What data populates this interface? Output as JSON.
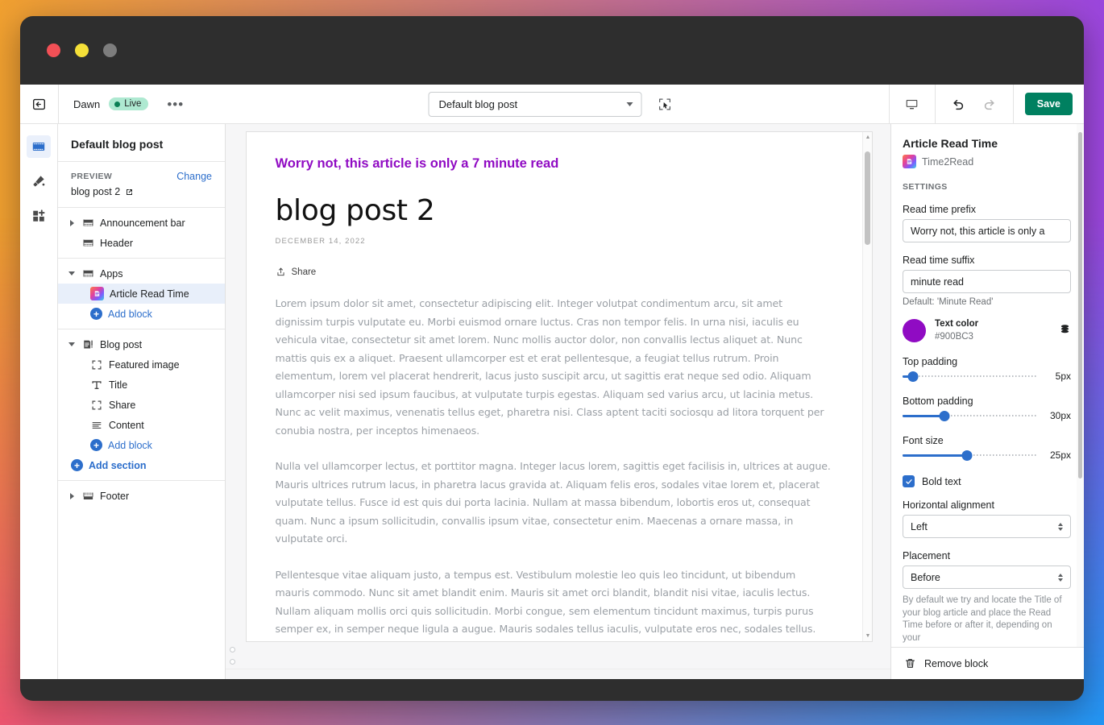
{
  "window": {
    "traffic_lights": [
      "close",
      "minimize",
      "maximize"
    ]
  },
  "toolbar": {
    "exit_icon": "exit-to-app-icon",
    "theme_name": "Dawn",
    "status_badge": "Live",
    "more_label": "•••",
    "page_selector_value": "Default blog post",
    "inspector_icon": "select-element-icon",
    "device_icon": "desktop-icon",
    "undo_icon": "undo-icon",
    "redo_icon": "redo-icon",
    "save_label": "Save"
  },
  "rail": {
    "items": [
      {
        "name": "sections-icon",
        "label": "Sections",
        "active": true
      },
      {
        "name": "theme-settings-icon",
        "label": "Theme settings",
        "active": false
      },
      {
        "name": "app-embeds-icon",
        "label": "App embeds",
        "active": false
      }
    ]
  },
  "sidebar": {
    "title": "Default blog post",
    "preview_label": "PREVIEW",
    "change_label": "Change",
    "preview_value": "blog post 2",
    "preview_external_icon": "external-link-icon",
    "groups": [
      {
        "rows": [
          {
            "label": "Announcement bar",
            "icon": "section-icon",
            "twisty": "right",
            "indent": 0,
            "type": "section"
          },
          {
            "label": "Header",
            "icon": "section-icon",
            "twisty": "none",
            "indent": 0,
            "type": "section"
          }
        ]
      },
      {
        "rows": [
          {
            "label": "Apps",
            "icon": "section-icon",
            "twisty": "down",
            "indent": 0,
            "type": "section"
          },
          {
            "label": "Article Read Time",
            "icon": "app-block-icon",
            "twisty": "none",
            "indent": 1,
            "type": "block",
            "selected": true
          },
          {
            "label": "Add block",
            "icon": "plus-circle-icon",
            "twisty": "none",
            "indent": 1,
            "type": "add"
          }
        ]
      },
      {
        "rows": [
          {
            "label": "Blog post",
            "icon": "blog-post-icon",
            "twisty": "down",
            "indent": 0,
            "type": "section"
          },
          {
            "label": "Featured image",
            "icon": "image-placeholder-icon",
            "twisty": "none",
            "indent": 1,
            "type": "block"
          },
          {
            "label": "Title",
            "icon": "text-title-icon",
            "twisty": "none",
            "indent": 1,
            "type": "block"
          },
          {
            "label": "Share",
            "icon": "image-placeholder-icon",
            "twisty": "none",
            "indent": 1,
            "type": "block"
          },
          {
            "label": "Content",
            "icon": "paragraph-lines-icon",
            "twisty": "none",
            "indent": 1,
            "type": "block"
          },
          {
            "label": "Add block",
            "icon": "plus-circle-icon",
            "twisty": "none",
            "indent": 1,
            "type": "add"
          },
          {
            "label": "Add section",
            "icon": "plus-circle-icon",
            "twisty": "none",
            "indent": 0,
            "type": "add"
          }
        ]
      },
      {
        "rows": [
          {
            "label": "Footer",
            "icon": "section-icon",
            "twisty": "right",
            "indent": 0,
            "type": "section"
          }
        ]
      }
    ]
  },
  "preview": {
    "read_time_text": "Worry not, this article is only a 7 minute read",
    "read_time_color": "#900BC3",
    "post_title": "blog post 2",
    "post_date": "DECEMBER 14, 2022",
    "share_label": "Share",
    "share_icon": "share-upload-icon",
    "paragraphs": [
      "Lorem ipsum dolor sit amet, consectetur adipiscing elit. Integer volutpat condimentum arcu, sit amet dignissim turpis vulputate eu. Morbi euismod ornare luctus. Cras non tempor felis. In urna nisi, iaculis eu vehicula vitae, consectetur sit amet lorem. Nunc mollis auctor dolor, non convallis lectus aliquet at. Nunc mattis quis ex a aliquet. Praesent ullamcorper est et erat pellentesque, a feugiat tellus rutrum. Proin elementum, lorem vel placerat hendrerit, lacus justo suscipit arcu, ut sagittis erat neque sed odio. Aliquam ullamcorper nisi sed ipsum faucibus, at vulputate turpis egestas. Aliquam sed varius arcu, ut lacinia metus. Nunc ac velit maximus, venenatis tellus eget, pharetra nisi. Class aptent taciti sociosqu ad litora torquent per conubia nostra, per inceptos himenaeos.",
      "Nulla vel ullamcorper lectus, et porttitor magna. Integer lacus lorem, sagittis eget facilisis in, ultrices at augue. Mauris ultrices rutrum lacus, in pharetra lacus gravida at. Aliquam felis eros, sodales vitae lorem et, placerat vulputate tellus. Fusce id est quis dui porta lacinia. Nullam at massa bibendum, lobortis eros ut, consequat quam. Nunc a ipsum sollicitudin, convallis ipsum vitae, consectetur enim. Maecenas a ornare massa, in vulputate orci.",
      "Pellentesque vitae aliquam justo, a tempus est. Vestibulum molestie leo quis leo tincidunt, ut bibendum mauris commodo. Nunc sit amet blandit enim. Mauris sit amet orci blandit, blandit nisi vitae, iaculis lectus. Nullam aliquam mollis orci quis sollicitudin. Morbi congue, sem elementum tincidunt maximus, turpis purus semper ex, in semper neque ligula a augue. Mauris sodales tellus iaculis, vulputate eros nec, sodales tellus."
    ]
  },
  "settings": {
    "title": "Article Read Time",
    "app_name": "Time2Read",
    "section_label": "SETTINGS",
    "prefix_label": "Read time prefix",
    "prefix_value": "Worry not, this article is only a",
    "suffix_label": "Read time suffix",
    "suffix_value": "minute read",
    "suffix_help": "Default: 'Minute Read'",
    "color_label": "Text color",
    "color_hex": "#900BC3",
    "color_stack_icon": "color-library-icon",
    "sliders": [
      {
        "label": "Top padding",
        "value": "5px",
        "percent": 8
      },
      {
        "label": "Bottom padding",
        "value": "30px",
        "percent": 31
      },
      {
        "label": "Font size",
        "value": "25px",
        "percent": 48
      }
    ],
    "bold_label": "Bold text",
    "bold_checked": true,
    "alignment_label": "Horizontal alignment",
    "alignment_value": "Left",
    "placement_label": "Placement",
    "placement_value": "Before",
    "placement_help": "By default we try and locate the Title of your blog article and place the Read Time before or after it, depending on your",
    "remove_label": "Remove block",
    "remove_icon": "trash-icon"
  }
}
